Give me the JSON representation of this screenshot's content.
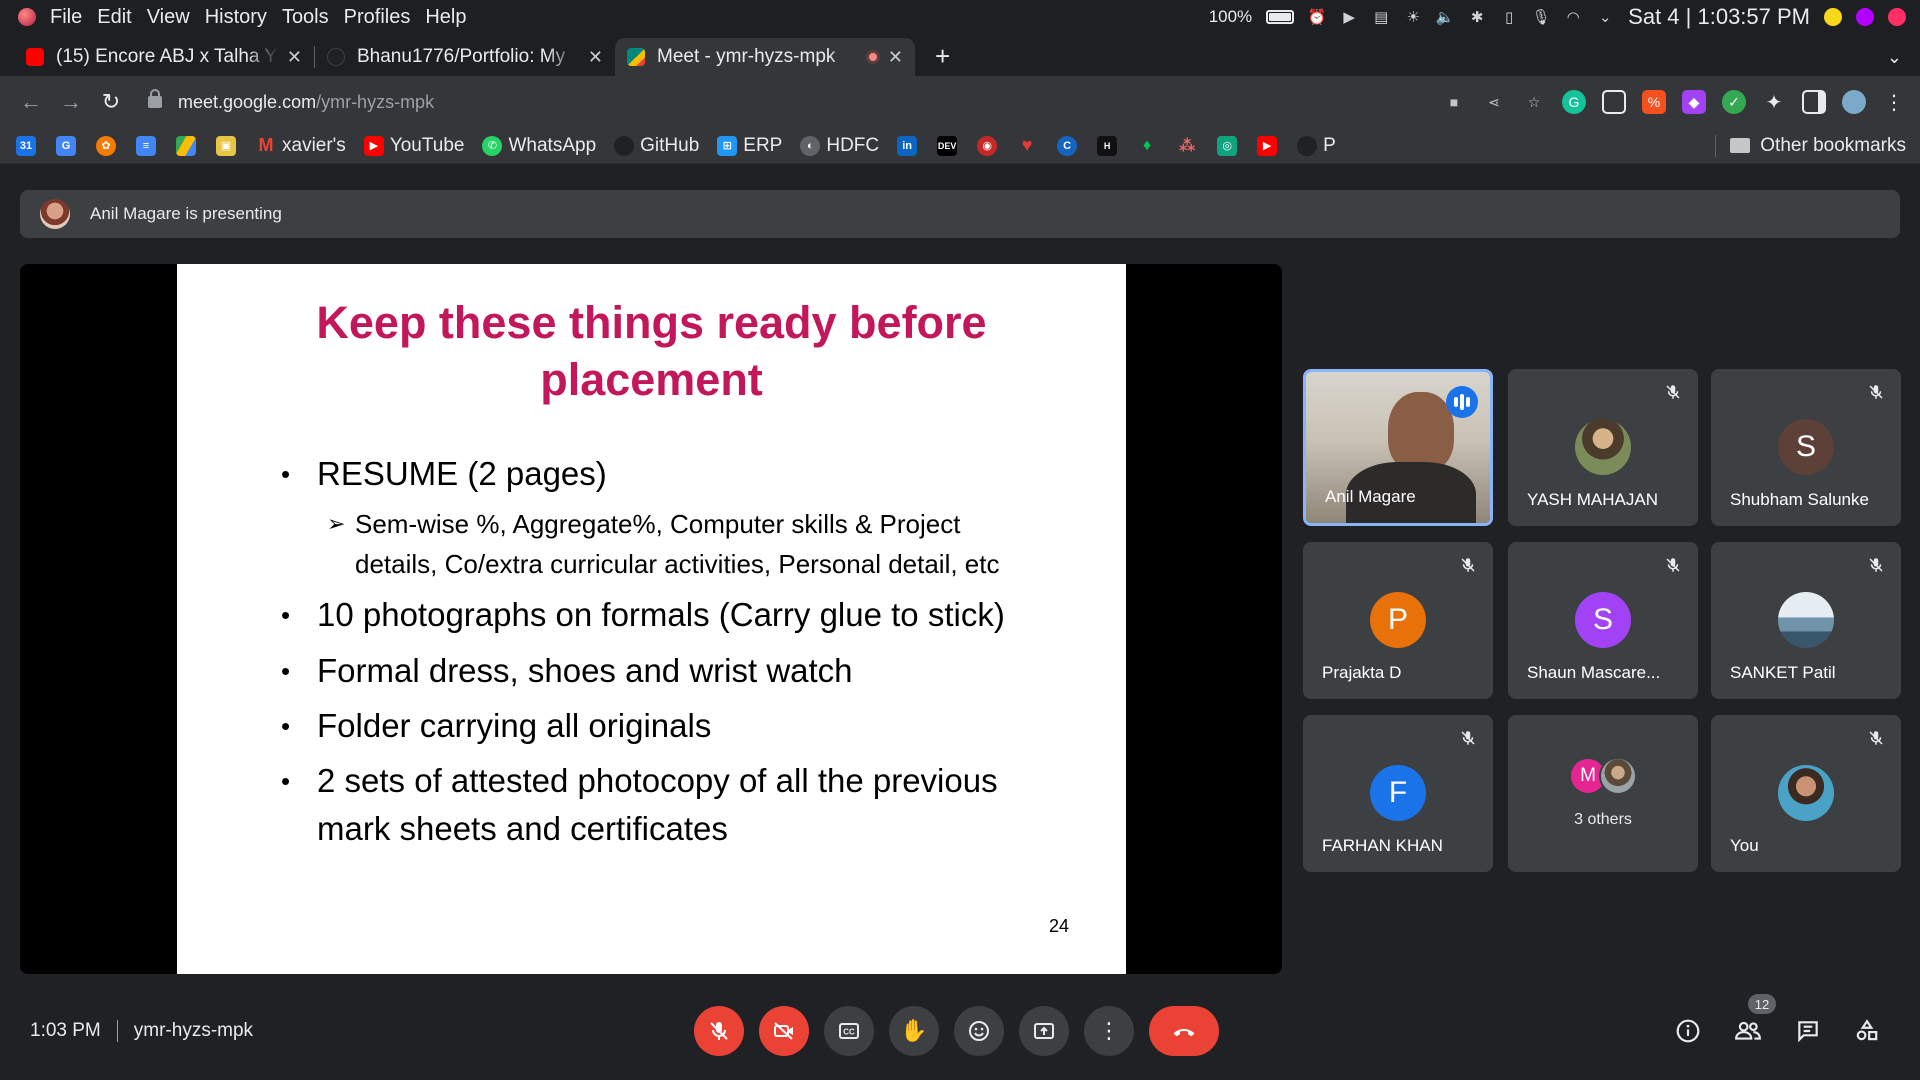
{
  "os": {
    "menu": [
      "File",
      "Edit",
      "View",
      "History",
      "Tools",
      "Profiles",
      "Help"
    ],
    "battery": "100%",
    "clock": "Sat 4 | 1:03:57 PM"
  },
  "tabs": [
    {
      "title": "(15) Encore ABJ x Talha Y",
      "favicon_color": "#ff0000"
    },
    {
      "title": "Bhanu1776/Portfolio: My",
      "favicon_color": "#202124"
    },
    {
      "title": "Meet - ymr-hyzs-mpk",
      "favicon_color": "#00897b",
      "active": true
    }
  ],
  "address": {
    "host": "meet.google.com",
    "path": "/ymr-hyzs-mpk"
  },
  "bookmarks": [
    {
      "label": "",
      "icon": "google-calendar-icon",
      "color": "#1a73e8"
    },
    {
      "label": "",
      "icon": "google-translate-icon",
      "color": "#4285f4"
    },
    {
      "label": "",
      "icon": "bookmark-app-icon",
      "color": "#f57c00"
    },
    {
      "label": "",
      "icon": "google-docs-icon",
      "color": "#4285f4"
    },
    {
      "label": "",
      "icon": "google-drive-icon",
      "color": "#fbbc04"
    },
    {
      "label": "",
      "icon": "google-photos-icon",
      "color": "#e8c547"
    },
    {
      "label": "xavier's",
      "icon": "gmail-icon",
      "color": "#ea4335"
    },
    {
      "label": "YouTube",
      "icon": "youtube-icon",
      "color": "#ff0000"
    },
    {
      "label": "WhatsApp",
      "icon": "whatsapp-icon",
      "color": "#25d366"
    },
    {
      "label": "GitHub",
      "icon": "github-icon",
      "color": "#202124"
    },
    {
      "label": "ERP",
      "icon": "windows-icon",
      "color": "#2196f3"
    },
    {
      "label": "HDFC",
      "icon": "hdfc-icon",
      "color": "#5f6368"
    },
    {
      "label": "",
      "icon": "linkedin-icon",
      "color": "#0a66c2"
    },
    {
      "label": "",
      "icon": "dev-icon",
      "color": "#000000"
    },
    {
      "label": "",
      "icon": "bookmark-red-icon",
      "color": "#c62828"
    },
    {
      "label": "",
      "icon": "heart-icon",
      "color": "#e53935"
    },
    {
      "label": "",
      "icon": "c-icon",
      "color": "#1565c0"
    },
    {
      "label": "",
      "icon": "hashnode-icon",
      "color": "#111111"
    },
    {
      "label": "",
      "icon": "leaf-icon",
      "color": "#00c853"
    },
    {
      "label": "",
      "icon": "asana-icon",
      "color": "#f06a6a"
    },
    {
      "label": "",
      "icon": "openai-icon",
      "color": "#10a37f"
    },
    {
      "label": "",
      "icon": "youtube-icon",
      "color": "#ff0000"
    },
    {
      "label": "P",
      "icon": "github-icon",
      "color": "#202124"
    }
  ],
  "other_bookmarks": "Other bookmarks",
  "presenting": "Anil Magare is presenting",
  "slide": {
    "title_line1": "Keep these things ready before",
    "title_line2": "placement",
    "bullet1": "RESUME (2 pages)",
    "sub1_line1": "Sem-wise %, Aggregate%, Computer skills & Project",
    "sub1_line2": "details, Co/extra curricular activities, Personal detail, etc",
    "bullet2": "10 photographs on formals (Carry glue to stick)",
    "bullet3": "Formal dress, shoes  and wrist watch",
    "bullet4": "Folder carrying all originals",
    "bullet5_line1": "2 sets of attested photocopy of all the previous",
    "bullet5_line2": "mark sheets and certificates",
    "page": "24"
  },
  "participants": [
    {
      "name": "Anil Magare",
      "type": "video",
      "speaking": true
    },
    {
      "name": "YASH MAHAJAN",
      "type": "photo",
      "color": "#6d5a3a",
      "muted": true
    },
    {
      "name": "Shubham Salunke",
      "initial": "S",
      "color": "#5d4037",
      "muted": true
    },
    {
      "name": "Prajakta D",
      "initial": "P",
      "color": "#e8710a",
      "muted": true
    },
    {
      "name": "Shaun Mascare...",
      "initial": "S",
      "color": "#a142f4",
      "muted": true
    },
    {
      "name": "SANKET Patil",
      "type": "photo",
      "color": "#9fb8c7",
      "muted": true
    },
    {
      "name": "FARHAN KHAN",
      "initial": "F",
      "color": "#1a73e8",
      "muted": true
    },
    {
      "name": "3 others",
      "type": "others",
      "initial": "M",
      "color": "#e52592"
    },
    {
      "name": "You",
      "type": "photo",
      "color": "#4aa3c7",
      "muted": true
    }
  ],
  "footer": {
    "time": "1:03 PM",
    "code": "ymr-hyzs-mpk",
    "people_count": "12"
  }
}
